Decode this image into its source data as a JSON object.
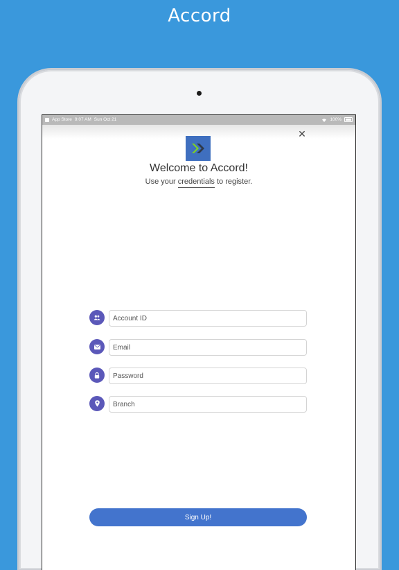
{
  "banner": {
    "title": "Accord"
  },
  "status_bar": {
    "carrier": "App Store",
    "time": "9:07 AM",
    "date": "Sun Oct 21",
    "battery": "100%"
  },
  "dialog": {
    "close_icon": "close-icon",
    "logo_icon": "accord-chevron-logo",
    "title": "Welcome to Accord!",
    "subtitle_prefix": "Use your ",
    "subtitle_link": "credentials",
    "subtitle_suffix": " to register."
  },
  "form": {
    "fields": [
      {
        "icon": "group-icon",
        "placeholder": "Account ID"
      },
      {
        "icon": "email-icon",
        "placeholder": "Email"
      },
      {
        "icon": "lock-icon",
        "placeholder": "Password"
      },
      {
        "icon": "location-pin-icon",
        "placeholder": "Branch"
      }
    ],
    "submit_label": "Sign Up!"
  },
  "colors": {
    "background": "#3a98dc",
    "field_icon_bg": "#5b58b9",
    "button_bg": "#4374cd",
    "logo_bg": "#3f6fbf",
    "logo_accent": "#7ed321"
  }
}
